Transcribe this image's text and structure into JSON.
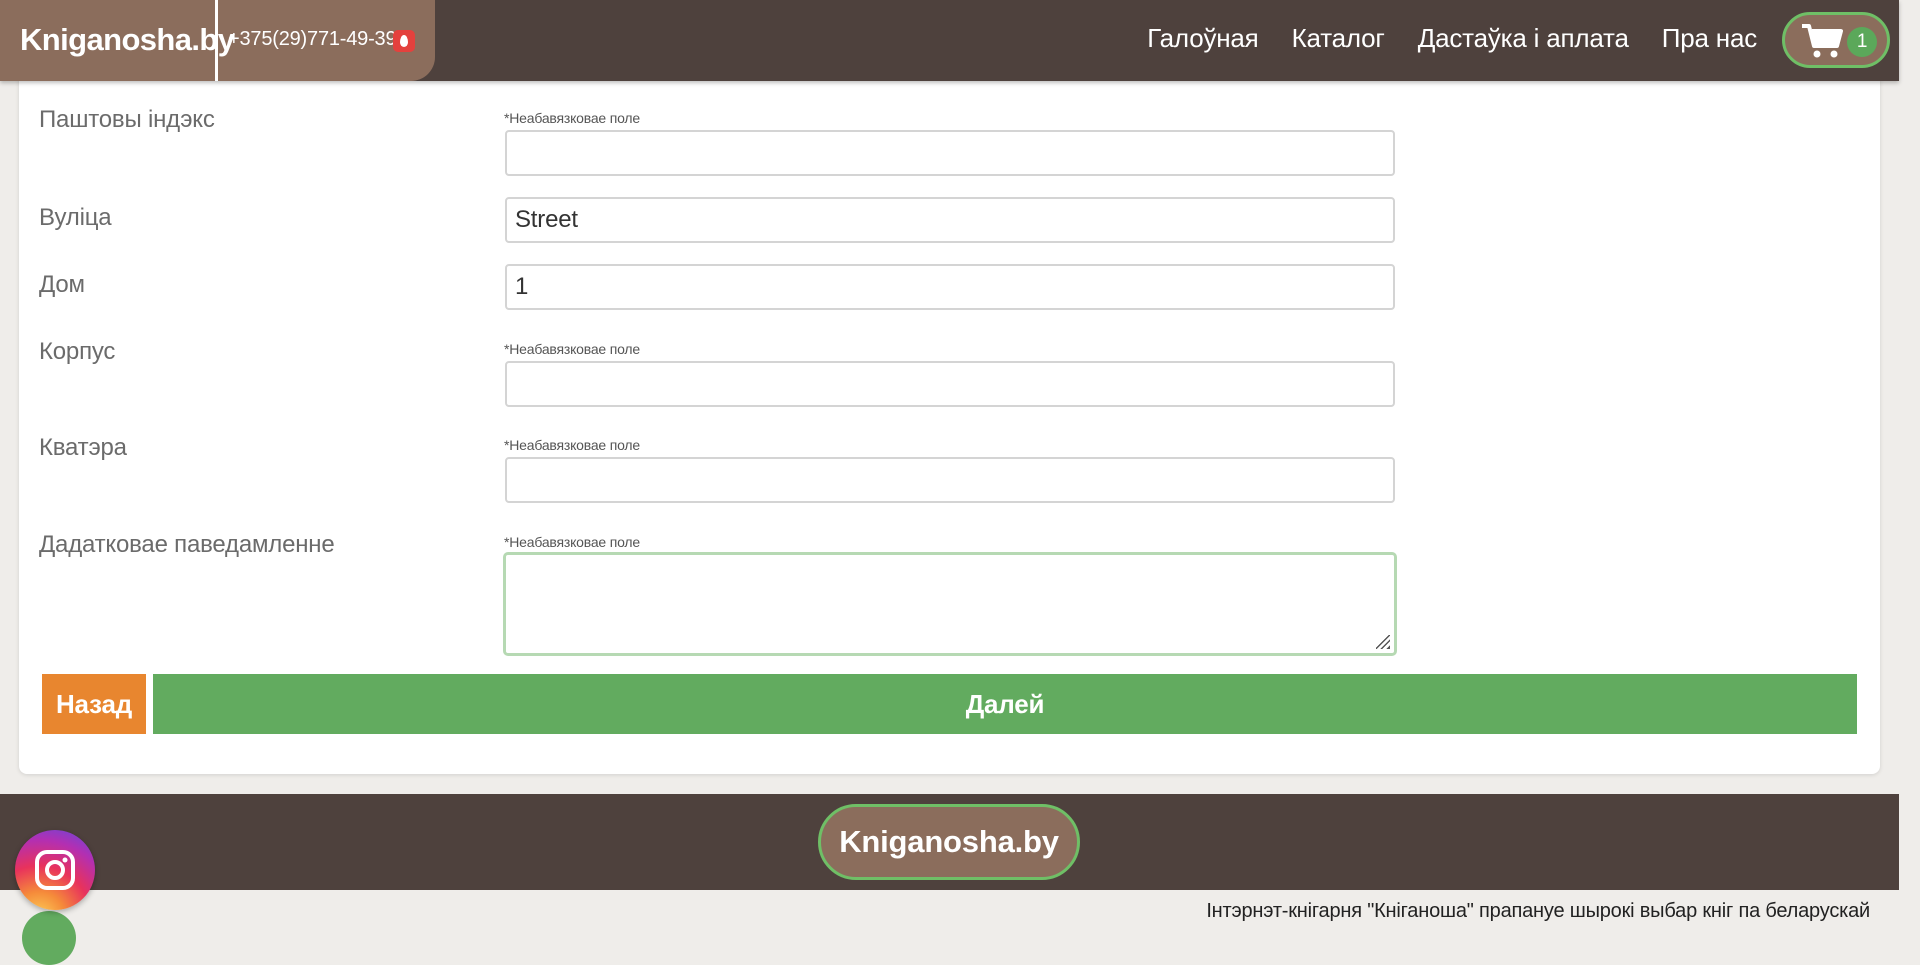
{
  "header": {
    "logo": "Kniganosha.by",
    "phone": "+375(29)771-49-39",
    "nav": [
      "Галоўная",
      "Каталог",
      "Дастаўка і аплата",
      "Пра нас"
    ],
    "cart_count": "1"
  },
  "form": {
    "optional_hint": "*Неабавязковае поле",
    "fields": [
      {
        "label": "Паштовы індэкс",
        "value": ""
      },
      {
        "label": "Вуліца",
        "value": "Street"
      },
      {
        "label": "Дом",
        "value": "1"
      },
      {
        "label": "Корпус",
        "value": ""
      },
      {
        "label": "Кватэра",
        "value": ""
      },
      {
        "label": "Дадатковае паведамленне",
        "value": ""
      }
    ],
    "back_label": "Назад",
    "next_label": "Далей"
  },
  "footer": {
    "logo": "Kniganosha.by",
    "text": "Інтэрнэт-кнігарня \"Кніганоша\" прапануе шырокі выбар кніг па беларускай"
  },
  "icons": {
    "operator": "mts-icon",
    "cart": "cart-icon",
    "social": "instagram-icon"
  },
  "colors": {
    "header_bg": "#4e413d",
    "brand_bg": "#8b6d5c",
    "accent_green": "#62ab5f",
    "accent_orange": "#e8862f"
  }
}
